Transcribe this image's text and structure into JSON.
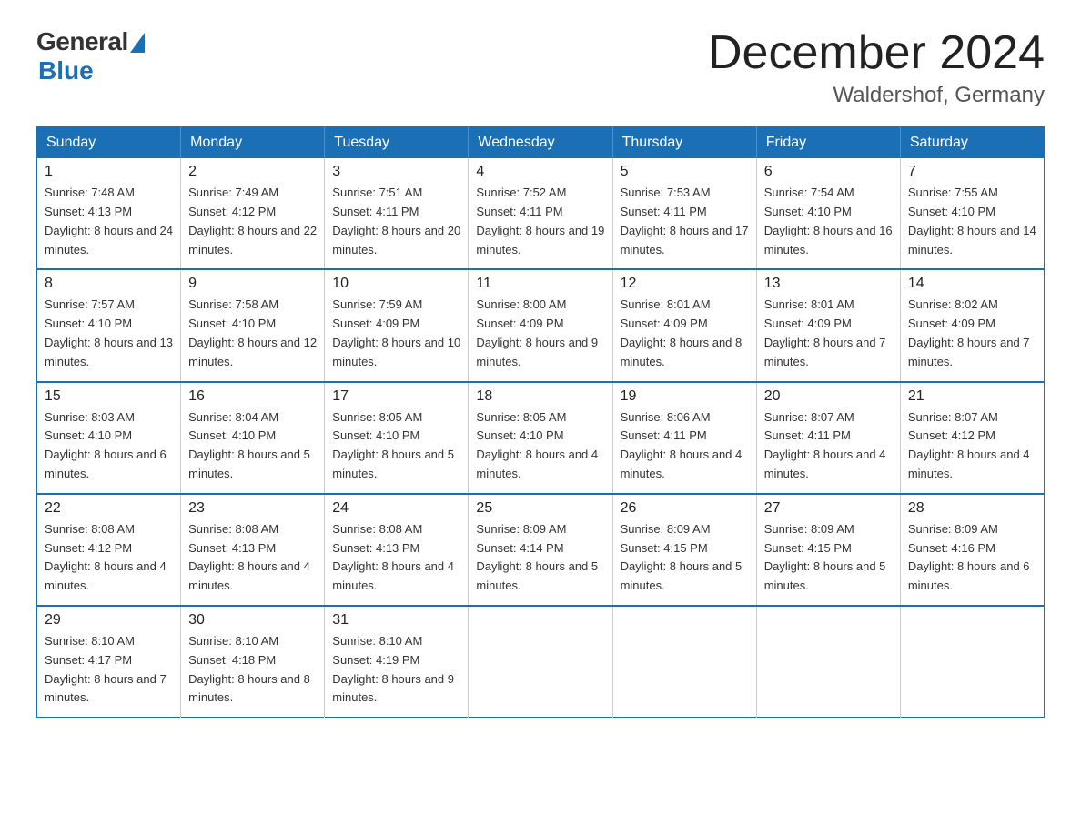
{
  "logo": {
    "general_text": "General",
    "blue_text": "Blue"
  },
  "title": "December 2024",
  "location": "Waldershof, Germany",
  "days_of_week": [
    "Sunday",
    "Monday",
    "Tuesday",
    "Wednesday",
    "Thursday",
    "Friday",
    "Saturday"
  ],
  "weeks": [
    [
      {
        "day": "1",
        "sunrise": "7:48 AM",
        "sunset": "4:13 PM",
        "daylight": "8 hours and 24 minutes."
      },
      {
        "day": "2",
        "sunrise": "7:49 AM",
        "sunset": "4:12 PM",
        "daylight": "8 hours and 22 minutes."
      },
      {
        "day": "3",
        "sunrise": "7:51 AM",
        "sunset": "4:11 PM",
        "daylight": "8 hours and 20 minutes."
      },
      {
        "day": "4",
        "sunrise": "7:52 AM",
        "sunset": "4:11 PM",
        "daylight": "8 hours and 19 minutes."
      },
      {
        "day": "5",
        "sunrise": "7:53 AM",
        "sunset": "4:11 PM",
        "daylight": "8 hours and 17 minutes."
      },
      {
        "day": "6",
        "sunrise": "7:54 AM",
        "sunset": "4:10 PM",
        "daylight": "8 hours and 16 minutes."
      },
      {
        "day": "7",
        "sunrise": "7:55 AM",
        "sunset": "4:10 PM",
        "daylight": "8 hours and 14 minutes."
      }
    ],
    [
      {
        "day": "8",
        "sunrise": "7:57 AM",
        "sunset": "4:10 PM",
        "daylight": "8 hours and 13 minutes."
      },
      {
        "day": "9",
        "sunrise": "7:58 AM",
        "sunset": "4:10 PM",
        "daylight": "8 hours and 12 minutes."
      },
      {
        "day": "10",
        "sunrise": "7:59 AM",
        "sunset": "4:09 PM",
        "daylight": "8 hours and 10 minutes."
      },
      {
        "day": "11",
        "sunrise": "8:00 AM",
        "sunset": "4:09 PM",
        "daylight": "8 hours and 9 minutes."
      },
      {
        "day": "12",
        "sunrise": "8:01 AM",
        "sunset": "4:09 PM",
        "daylight": "8 hours and 8 minutes."
      },
      {
        "day": "13",
        "sunrise": "8:01 AM",
        "sunset": "4:09 PM",
        "daylight": "8 hours and 7 minutes."
      },
      {
        "day": "14",
        "sunrise": "8:02 AM",
        "sunset": "4:09 PM",
        "daylight": "8 hours and 7 minutes."
      }
    ],
    [
      {
        "day": "15",
        "sunrise": "8:03 AM",
        "sunset": "4:10 PM",
        "daylight": "8 hours and 6 minutes."
      },
      {
        "day": "16",
        "sunrise": "8:04 AM",
        "sunset": "4:10 PM",
        "daylight": "8 hours and 5 minutes."
      },
      {
        "day": "17",
        "sunrise": "8:05 AM",
        "sunset": "4:10 PM",
        "daylight": "8 hours and 5 minutes."
      },
      {
        "day": "18",
        "sunrise": "8:05 AM",
        "sunset": "4:10 PM",
        "daylight": "8 hours and 4 minutes."
      },
      {
        "day": "19",
        "sunrise": "8:06 AM",
        "sunset": "4:11 PM",
        "daylight": "8 hours and 4 minutes."
      },
      {
        "day": "20",
        "sunrise": "8:07 AM",
        "sunset": "4:11 PM",
        "daylight": "8 hours and 4 minutes."
      },
      {
        "day": "21",
        "sunrise": "8:07 AM",
        "sunset": "4:12 PM",
        "daylight": "8 hours and 4 minutes."
      }
    ],
    [
      {
        "day": "22",
        "sunrise": "8:08 AM",
        "sunset": "4:12 PM",
        "daylight": "8 hours and 4 minutes."
      },
      {
        "day": "23",
        "sunrise": "8:08 AM",
        "sunset": "4:13 PM",
        "daylight": "8 hours and 4 minutes."
      },
      {
        "day": "24",
        "sunrise": "8:08 AM",
        "sunset": "4:13 PM",
        "daylight": "8 hours and 4 minutes."
      },
      {
        "day": "25",
        "sunrise": "8:09 AM",
        "sunset": "4:14 PM",
        "daylight": "8 hours and 5 minutes."
      },
      {
        "day": "26",
        "sunrise": "8:09 AM",
        "sunset": "4:15 PM",
        "daylight": "8 hours and 5 minutes."
      },
      {
        "day": "27",
        "sunrise": "8:09 AM",
        "sunset": "4:15 PM",
        "daylight": "8 hours and 5 minutes."
      },
      {
        "day": "28",
        "sunrise": "8:09 AM",
        "sunset": "4:16 PM",
        "daylight": "8 hours and 6 minutes."
      }
    ],
    [
      {
        "day": "29",
        "sunrise": "8:10 AM",
        "sunset": "4:17 PM",
        "daylight": "8 hours and 7 minutes."
      },
      {
        "day": "30",
        "sunrise": "8:10 AM",
        "sunset": "4:18 PM",
        "daylight": "8 hours and 8 minutes."
      },
      {
        "day": "31",
        "sunrise": "8:10 AM",
        "sunset": "4:19 PM",
        "daylight": "8 hours and 9 minutes."
      },
      null,
      null,
      null,
      null
    ]
  ]
}
